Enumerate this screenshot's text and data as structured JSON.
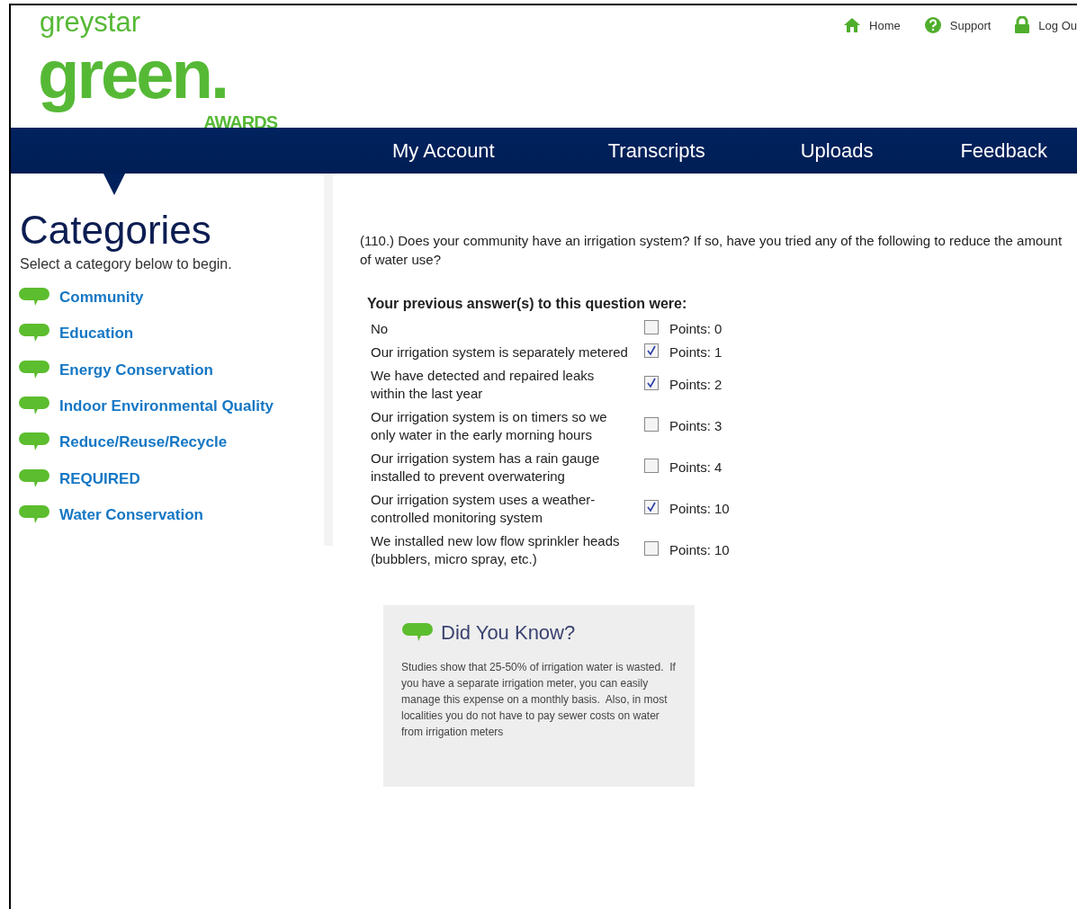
{
  "logo": {
    "top": "greystar",
    "main": "green.",
    "bottom": "AWARDS"
  },
  "top_links": [
    {
      "label": "Home",
      "kind": "home"
    },
    {
      "label": "Support",
      "kind": "help"
    },
    {
      "label": "Log Ou",
      "kind": "lock"
    }
  ],
  "nav": [
    {
      "label": "My Account"
    },
    {
      "label": "Transcripts"
    },
    {
      "label": "Uploads"
    },
    {
      "label": "Feedback"
    }
  ],
  "sidebar": {
    "title": "Categories",
    "hint": "Select a category below to begin.",
    "items": [
      {
        "label": "Community"
      },
      {
        "label": "Education"
      },
      {
        "label": "Energy Conservation"
      },
      {
        "label": "Indoor Environmental Quality"
      },
      {
        "label": "Reduce/Reuse/Recycle"
      },
      {
        "label": "REQUIRED"
      },
      {
        "label": "Water Conservation"
      }
    ]
  },
  "question": {
    "text": "(110.) Does your community have an irrigation system? If so, have you tried any of the following to reduce the amount of water use?",
    "answers_heading": "Your previous answer(s) to this question were:",
    "answers": [
      {
        "label": "No",
        "checked": false,
        "points": "Points: 0"
      },
      {
        "label": "Our irrigation system is separately metered",
        "checked": true,
        "points": "Points: 1"
      },
      {
        "label": "We have detected and repaired leaks within the last year",
        "checked": true,
        "points": "Points: 2"
      },
      {
        "label": "Our irrigation system is on timers so we only water in the early morning hours",
        "checked": false,
        "points": "Points: 3"
      },
      {
        "label": "Our irrigation system has a rain gauge installed to prevent overwatering",
        "checked": false,
        "points": "Points: 4"
      },
      {
        "label": "Our irrigation system uses a weather-controlled monitoring system",
        "checked": true,
        "points": "Points: 10"
      },
      {
        "label": "We installed new low flow sprinkler heads (bubblers, micro spray, etc.)",
        "checked": false,
        "points": "Points: 10"
      }
    ]
  },
  "tip": {
    "title": "Did You Know?",
    "text": "Studies show that 25-50% of irrigation water is wasted.  If you have a separate irrigation meter, you can easily manage this expense on a monthly basis.  Also, in most localities you do not have to pay sewer costs on water from irrigation meters"
  }
}
